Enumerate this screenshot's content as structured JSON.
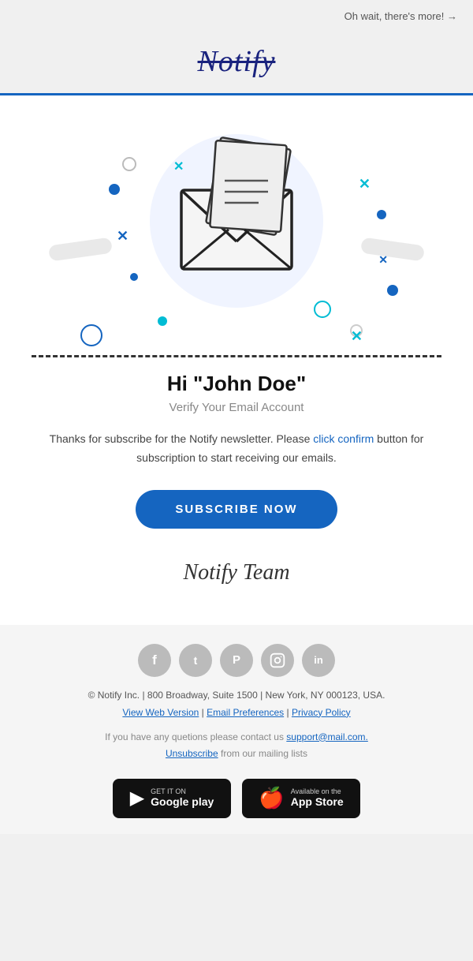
{
  "topbar": {
    "link_text": "Oh wait, there's more! →"
  },
  "logo": {
    "text": "Notify"
  },
  "hero": {
    "greeting": "Hi \"John Doe\"",
    "subtitle": "Verify Your Email Account",
    "body_text_1": "Thanks for subscribe for the Notify newsletter. Please ",
    "body_text_link": "click confirm",
    "body_text_2": " button for subscription to start receiving our emails.",
    "button_label": "SUBSCRIBE NOW",
    "signature": "Notify Team"
  },
  "footer": {
    "address": "© Notify Inc.  |  800 Broadway, Suite 1500  |  New York, NY 000123, USA.",
    "link_web": "View Web Version",
    "link_email": "Email Preferences",
    "link_privacy": "Privacy Policy",
    "contact_text": "If you have any quetions please contact us ",
    "contact_email": "support@mail.com.",
    "unsubscribe_text": "Unsubscribe",
    "unsubscribe_suffix": " from our mailing lists",
    "social": [
      {
        "name": "facebook",
        "icon": "f"
      },
      {
        "name": "twitter",
        "icon": "t"
      },
      {
        "name": "pinterest",
        "icon": "p"
      },
      {
        "name": "instagram",
        "icon": "📷"
      },
      {
        "name": "linkedin",
        "icon": "in"
      }
    ],
    "google_play_small": "GET IT ON",
    "google_play_big": "Google play",
    "app_store_small": "Available on the",
    "app_store_big": "App Store"
  }
}
